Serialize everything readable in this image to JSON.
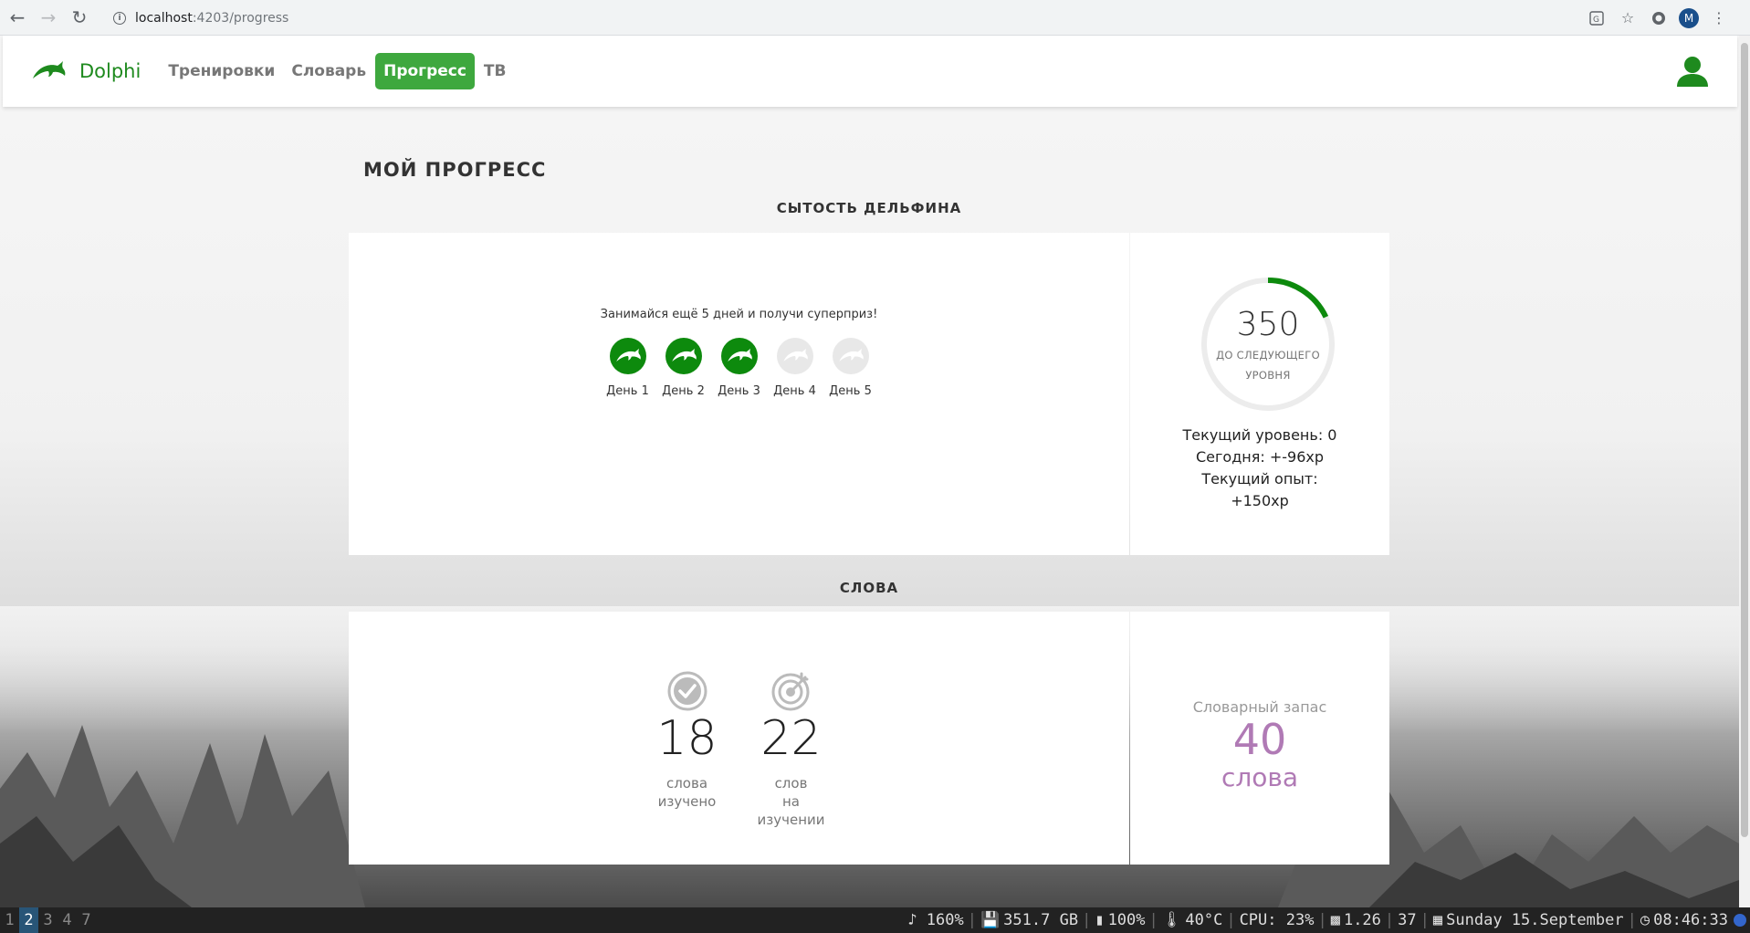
{
  "browser": {
    "url_host": "localhost",
    "url_path": ":4203/progress",
    "profile_initial": "M"
  },
  "header": {
    "brand": "Dolphi",
    "menu": [
      {
        "label": "Тренировки",
        "active": false
      },
      {
        "label": "Словарь",
        "active": false
      },
      {
        "label": "Прогресс",
        "active": true
      },
      {
        "label": "ТВ",
        "active": false
      }
    ]
  },
  "page": {
    "title": "МОЙ ПРОГРЕСС",
    "satiety_title": "СЫТОСТЬ ДЕЛЬФИНА",
    "words_title": "СЛОВА"
  },
  "streak": {
    "message": "Занимайся ещё 5 дней и получи суперприз!",
    "days": [
      {
        "label": "День 1",
        "done": true
      },
      {
        "label": "День 2",
        "done": true
      },
      {
        "label": "День 3",
        "done": true
      },
      {
        "label": "День 4",
        "done": false
      },
      {
        "label": "День 5",
        "done": false
      }
    ]
  },
  "level": {
    "points_to_next": "350",
    "caption_line1": "ДО СЛЕДУЮЩЕГО",
    "caption_line2": "УРОВНЯ",
    "progress_fraction": 0.18,
    "current_level": "Текущий уровень: 0",
    "today": "Сегодня: +-96xp",
    "current_xp_label": "Текущий опыт:",
    "current_xp_value": "+150xp"
  },
  "words": {
    "learned": {
      "value": "18",
      "line1": "слова",
      "line2": "изучено"
    },
    "learning": {
      "value": "22",
      "line1": "слов",
      "line2": "на изучении"
    },
    "vocab_label": "Словарный запас",
    "vocab_value": "40",
    "vocab_unit": "слова"
  },
  "taskbar": {
    "workspaces": [
      "1",
      "2",
      "3",
      "4",
      "7"
    ],
    "active_workspace": "2",
    "volume": "♪ 160%",
    "disk": "351.7 GB",
    "battery": "100%",
    "temp": "40°C",
    "cpu": "CPU: 23%",
    "load": "1.26",
    "procs": "37",
    "date": "Sunday 15.September",
    "time": "08:46:33"
  },
  "colors": {
    "brand_green": "#1e8a1e",
    "active_menu": "#3ea83e",
    "vocab_purple": "#b07ab5"
  }
}
